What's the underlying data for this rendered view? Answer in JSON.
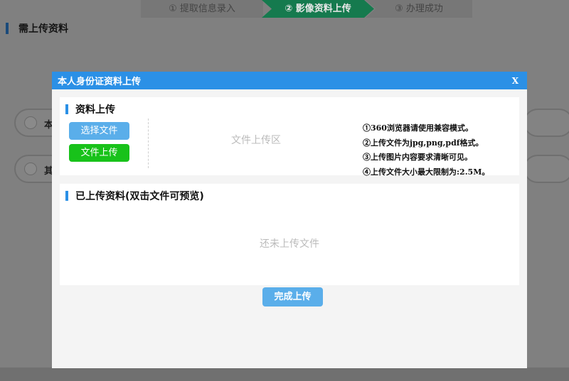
{
  "steps": [
    {
      "label": "① 提取信息录入"
    },
    {
      "label": "② 影像资料上传"
    },
    {
      "label": "③ 办理成功"
    }
  ],
  "background": {
    "heading": "需上传资料",
    "rows": [
      {
        "label": "本"
      },
      {
        "label": "其"
      }
    ]
  },
  "modal": {
    "title": "本人身份证资料上传",
    "close": "X",
    "upload_section": {
      "title": "资料上传",
      "choose_label": "选择文件",
      "upload_label": "文件上传",
      "drop_zone": "文件上传区",
      "tips": [
        "①360浏览器请使用兼容模式。",
        "②上传文件为jpg,png,pdf格式。",
        "③上传图片内容要求清晰可见。",
        "④上传文件大小最大限制为:2.5M。"
      ]
    },
    "uploaded_section": {
      "title": "已上传资料(双击文件可预览)",
      "empty_message": "还未上传文件"
    },
    "finish_label": "完成上传"
  },
  "colors": {
    "modal_header": "#2b90e6",
    "primary_button": "#5aaeea",
    "upload_button": "#18c21a",
    "active_step": "#157a4e"
  }
}
